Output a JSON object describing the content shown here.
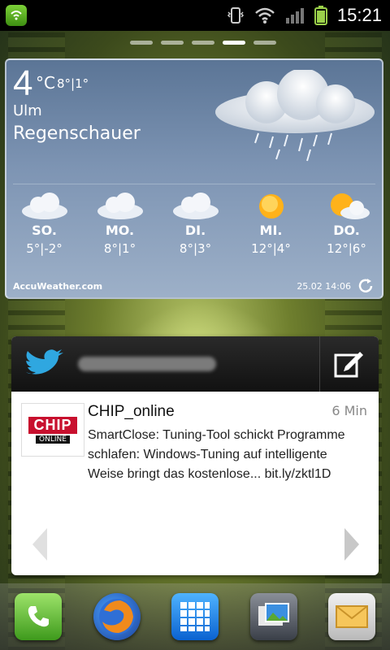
{
  "status": {
    "time": "15:21"
  },
  "weather": {
    "temp": "4",
    "unit": "°C",
    "range": "8°|1°",
    "city": "Ulm",
    "condition": "Regenschauer",
    "forecast": [
      {
        "day": "SO.",
        "range": "5°|-2°",
        "icon": "cloud-icon"
      },
      {
        "day": "MO.",
        "range": "8°|1°",
        "icon": "cloud-icon"
      },
      {
        "day": "DI.",
        "range": "8°|3°",
        "icon": "cloud-icon"
      },
      {
        "day": "MI.",
        "range": "12°|4°",
        "icon": "sun-icon"
      },
      {
        "day": "DO.",
        "range": "12°|6°",
        "icon": "sun-cloud-icon"
      }
    ],
    "brand": "AccuWeather.com",
    "updated": "25.02 14:06"
  },
  "twitter": {
    "tweet": {
      "name": "CHIP_online",
      "time": "6 Min",
      "text": "SmartClose: Tuning-Tool schickt Programme schlafen: Windows-Tuning auf intelligente Weise bringt das kostenlose... bit.ly/zktl1D",
      "avatar_logo": "CHIP",
      "avatar_sub": "ONLINE"
    }
  },
  "dock": {
    "items": [
      "phone-icon",
      "browser-icon",
      "apps-grid-icon",
      "gallery-icon",
      "mail-icon"
    ]
  }
}
